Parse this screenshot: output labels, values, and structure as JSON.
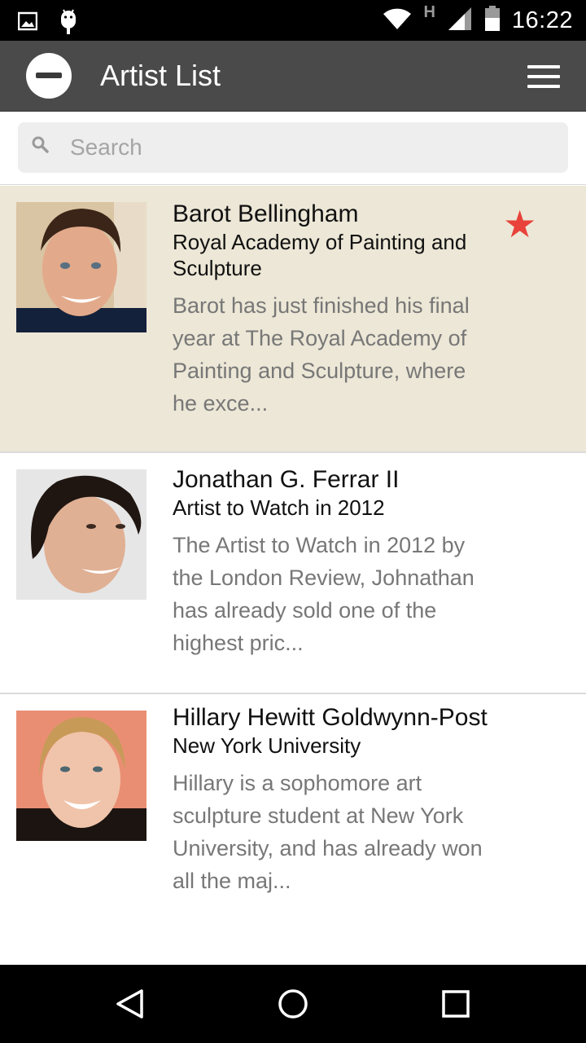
{
  "status_bar": {
    "time": "16:22",
    "network_type": "H",
    "icons": [
      "image-icon",
      "android-icon",
      "wifi-icon",
      "signal-icon",
      "battery-icon"
    ]
  },
  "app_bar": {
    "title": "Artist List",
    "logo_icon": "minus-circle-icon",
    "menu_icon": "hamburger-menu-icon"
  },
  "search": {
    "placeholder": "Search",
    "value": ""
  },
  "artists": [
    {
      "name": "Barot Bellingham",
      "school": "Royal Academy of Painting and Sculpture",
      "description": "Barot has just finished his final year at The Royal Academy of Painting and Sculpture, where he exce...",
      "favorite": true
    },
    {
      "name": "Jonathan G. Ferrar II",
      "school": "Artist to Watch in 2012",
      "description": "The Artist to Watch in 2012 by the London Review, Johnathan has already sold one of the highest pric...",
      "favorite": false
    },
    {
      "name": "Hillary Hewitt Goldwynn-Post",
      "school": "New York University",
      "description": "Hillary is a sophomore art sculpture student at New York University, and has already won all the maj...",
      "favorite": false
    }
  ],
  "colors": {
    "app_bar": "#4a4a4a",
    "favorite_row": "#ece7d6",
    "star": "#e8423a",
    "description_text": "#777777"
  },
  "nav_bar": {
    "buttons": [
      "back-icon",
      "home-icon",
      "recents-icon"
    ]
  }
}
